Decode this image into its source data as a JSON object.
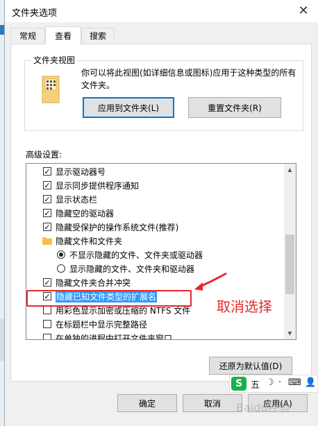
{
  "window": {
    "title": "文件夹选项",
    "close_glyph": "✕"
  },
  "tabs": [
    {
      "label": "常规"
    },
    {
      "label": "查看"
    },
    {
      "label": "搜索"
    }
  ],
  "folder_view": {
    "group_title": "文件夹视图",
    "description": "你可以将此视图(如详细信息或图标)应用于这种类型的所有文件夹。",
    "apply_button": "应用到文件夹(L)",
    "reset_button": "重置文件夹(R)"
  },
  "advanced": {
    "label": "高级设置:",
    "items": [
      {
        "type": "checkbox",
        "checked": true,
        "label": "显示驱动器号"
      },
      {
        "type": "checkbox",
        "checked": true,
        "label": "显示同步提供程序通知"
      },
      {
        "type": "checkbox",
        "checked": true,
        "label": "显示状态栏"
      },
      {
        "type": "checkbox",
        "checked": true,
        "label": "隐藏空的驱动器"
      },
      {
        "type": "checkbox",
        "checked": true,
        "label": "隐藏受保护的操作系统文件(推荐)"
      },
      {
        "type": "folder",
        "label": "隐藏文件和文件夹"
      },
      {
        "type": "radio",
        "checked": true,
        "label": "不显示隐藏的文件、文件夹或驱动器"
      },
      {
        "type": "radio",
        "checked": false,
        "label": "显示隐藏的文件、文件夹和驱动器"
      },
      {
        "type": "checkbox",
        "checked": true,
        "label": "隐藏文件夹合并冲突"
      },
      {
        "type": "checkbox",
        "checked": true,
        "label": "隐藏已知文件类型的扩展名",
        "selected": true
      },
      {
        "type": "checkbox",
        "checked": false,
        "label": "用彩色显示加密或压缩的 NTFS 文件"
      },
      {
        "type": "checkbox",
        "checked": false,
        "label": "在标题栏中显示完整路径"
      },
      {
        "type": "checkbox",
        "checked": false,
        "label": "在单独的进程中打开文件夹窗口"
      }
    ],
    "restore_defaults_button": "还原为默认值(D)"
  },
  "footer": {
    "ok_button": "确定",
    "cancel_button": "取消",
    "apply_button": "应用(A)"
  },
  "annotation": {
    "text": "取消选择",
    "color": "#e8262a"
  },
  "ime_bar": {
    "logo": "S",
    "mode": "五",
    "items": [
      "☽",
      "·",
      "⌨",
      "👤"
    ]
  },
  "watermark": "Baidu经验"
}
